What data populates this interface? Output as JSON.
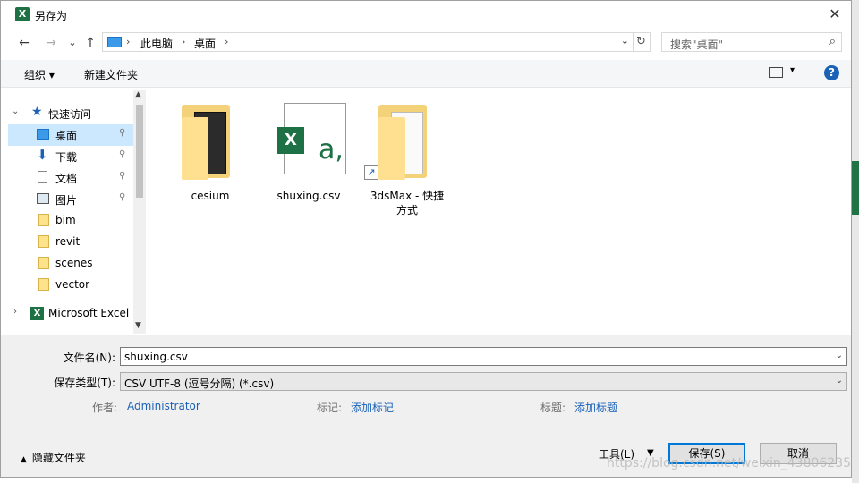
{
  "window": {
    "title": "另存为",
    "close_glyph": "✕"
  },
  "nav": {
    "back": "←",
    "forward": "→",
    "recent": "⌄",
    "up": "↑",
    "breadcrumb": [
      "此电脑",
      "桌面"
    ],
    "crumb_sep": "›",
    "refresh": "↻",
    "search_placeholder": "搜索\"桌面\"",
    "search_icon": "⌕"
  },
  "toolbar": {
    "organize": "组织 ▾",
    "new_folder": "新建文件夹",
    "help": "?"
  },
  "sidebar": {
    "quick_access": "快速访问",
    "items": [
      {
        "label": "桌面",
        "pinned": true,
        "icon": "desktop-icon"
      },
      {
        "label": "下载",
        "pinned": true,
        "icon": "download-icon"
      },
      {
        "label": "文档",
        "pinned": true,
        "icon": "document-icon"
      },
      {
        "label": "图片",
        "pinned": true,
        "icon": "picture-icon"
      },
      {
        "label": "bim",
        "icon": "folder-icon"
      },
      {
        "label": "revit",
        "icon": "folder-icon"
      },
      {
        "label": "scenes",
        "icon": "folder-icon"
      },
      {
        "label": "vector",
        "icon": "folder-icon"
      }
    ],
    "excel": "Microsoft Excel",
    "pin_glyph": "📌"
  },
  "files": [
    {
      "name": "cesium",
      "type": "folder"
    },
    {
      "name": "shuxing.csv",
      "type": "csv"
    },
    {
      "name": "3dsMax - 快捷方式",
      "line1": "3dsMax - 快捷",
      "line2": "方式",
      "type": "shortcut"
    }
  ],
  "form": {
    "filename_label": "文件名(N):",
    "filename_value": "shuxing.csv",
    "filetype_label": "保存类型(T):",
    "filetype_value": "CSV UTF-8 (逗号分隔) (*.csv)",
    "author_label": "作者:",
    "author_value": "Administrator",
    "tags_label": "标记:",
    "tags_value": "添加标记",
    "title_label": "标题:",
    "title_value": "添加标题"
  },
  "footer": {
    "hide_folders": "隐藏文件夹",
    "tools": "工具(L)",
    "save": "保存(S)",
    "cancel": "取消"
  },
  "watermark": "https://blog.csdn.net/weixin_43806235",
  "colors": {
    "excel_green": "#1e7145",
    "selection": "#cce8ff",
    "link": "#1b62b6",
    "primary_border": "#0078d7"
  }
}
